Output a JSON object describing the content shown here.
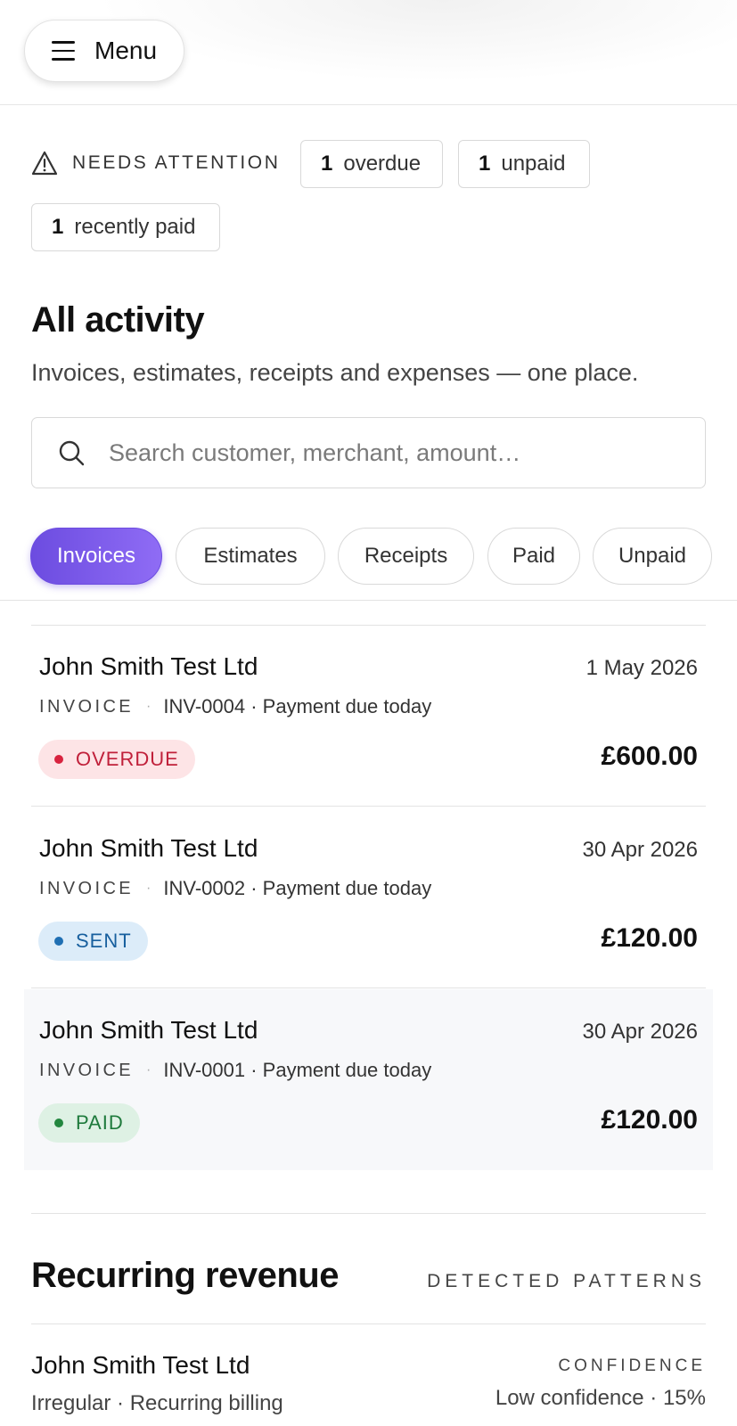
{
  "menu": {
    "label": "Menu"
  },
  "attention": {
    "heading": "NEEDS ATTENTION",
    "chips": [
      {
        "count": "1",
        "label": "overdue"
      },
      {
        "count": "1",
        "label": "unpaid"
      },
      {
        "count": "1",
        "label": "recently paid"
      }
    ]
  },
  "page": {
    "title": "All activity",
    "subtitle": "Invoices, estimates, receipts and expenses — one place."
  },
  "search": {
    "placeholder": "Search customer, merchant, amount…",
    "value": ""
  },
  "filters": [
    "Invoices",
    "Estimates",
    "Receipts",
    "Paid",
    "Unpaid"
  ],
  "active_filter": "Invoices",
  "rows": [
    {
      "name": "John Smith Test Ltd",
      "date": "1 May 2026",
      "type": "INVOICE",
      "ref": "INV-0004 · Payment due today",
      "status": "OVERDUE",
      "amount": "£600.00"
    },
    {
      "name": "John Smith Test Ltd",
      "date": "30 Apr 2026",
      "type": "INVOICE",
      "ref": "INV-0002 · Payment due today",
      "status": "SENT",
      "amount": "£120.00"
    },
    {
      "name": "John Smith Test Ltd",
      "date": "30 Apr 2026",
      "type": "INVOICE",
      "ref": "INV-0001 · Payment due today",
      "status": "PAID",
      "amount": "£120.00"
    }
  ],
  "status_colors": {
    "overdue": {
      "bg": "#fde4e6",
      "fg": "#c0203a"
    },
    "sent": {
      "bg": "#dcecf9",
      "fg": "#175f9e"
    },
    "paid": {
      "bg": "#def1e4",
      "fg": "#1e7a3c"
    }
  },
  "accent": "#7152e6",
  "recurring": {
    "title": "Recurring revenue",
    "tag": "DETECTED PATTERNS",
    "item": {
      "name": "John Smith Test Ltd",
      "description": "Irregular · Recurring billing",
      "confidence_label": "CONFIDENCE",
      "confidence": "Low confidence · 15%"
    }
  }
}
